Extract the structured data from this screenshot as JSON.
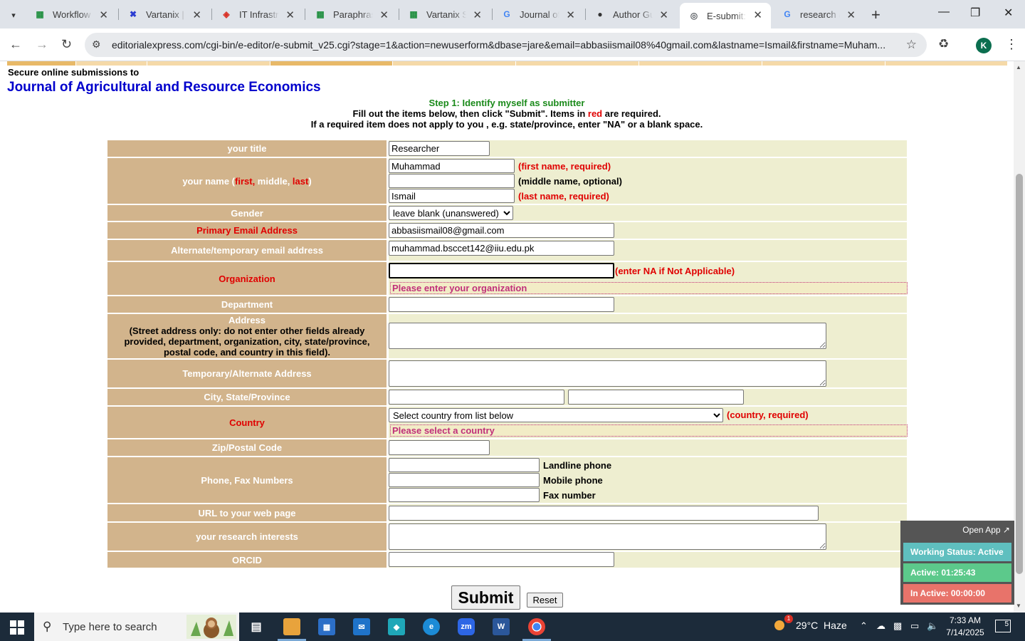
{
  "browser": {
    "tabs": [
      {
        "label": "Workflow F",
        "icon": "sheets-icon",
        "color": "#1e8e3e"
      },
      {
        "label": "Vartanix | S",
        "icon": "vartanix-icon",
        "color": "#2a3cd1"
      },
      {
        "label": "IT Infrastru",
        "icon": "diamond-icon",
        "color": "#d93025"
      },
      {
        "label": "Paraphrasin",
        "icon": "sheets-icon",
        "color": "#1e8e3e"
      },
      {
        "label": "Vartanix Se",
        "icon": "sheets-icon",
        "color": "#1e8e3e"
      },
      {
        "label": "Journal of A",
        "icon": "google-icon",
        "color": "#4285f4"
      },
      {
        "label": "Author Gui",
        "icon": "github-icon",
        "color": "#333333"
      },
      {
        "label": "E-submit: s",
        "icon": "globe-icon",
        "color": "#5f6368"
      },
      {
        "label": "research as",
        "icon": "google-icon",
        "color": "#4285f4"
      }
    ],
    "active_tab": 7,
    "url": "editorialexpress.com/cgi-bin/e-editor/e-submit_v25.cgi?stage=1&action=newuserform&dbase=jare&email=abbasiismail08%40gmail.com&lastname=Ismail&firstname=Muham...",
    "profile_initial": "K"
  },
  "header": {
    "secure_text": "Secure online submissions to",
    "journal_title": "Journal of Agricultural and Resource Economics"
  },
  "instructions": {
    "step": "Step 1: Identify myself as submitter",
    "line1_a": "Fill out the items below, then click \"Submit\". Items in ",
    "line1_red": "red",
    "line1_b": " are required.",
    "line2": "If a required item does not apply to you , e.g. state/province, enter \"NA\" or a blank space."
  },
  "form": {
    "title": {
      "label": "your title",
      "value": "Researcher"
    },
    "name": {
      "label_a": "your name (",
      "label_first": "first,",
      "label_mid": " middle, ",
      "label_last": "last",
      "label_close": ")",
      "first": "Muhammad",
      "first_hint": "(first name, required)",
      "middle": "",
      "middle_hint": "(middle name, optional)",
      "last": "Ismail",
      "last_hint": "(last name, required)"
    },
    "gender": {
      "label": "Gender",
      "value": "leave blank (unanswered)"
    },
    "email": {
      "label": "Primary Email Address",
      "value": "abbasiismail08@gmail.com"
    },
    "alt_email": {
      "label": "Alternate/temporary email address",
      "value": "muhammad.bsccet142@iiu.edu.pk"
    },
    "organization": {
      "label": "Organization",
      "value": "",
      "hint": "(enter NA if Not Applicable)",
      "error": "Please enter your organization"
    },
    "department": {
      "label": "Department",
      "value": ""
    },
    "address": {
      "title": "Address",
      "note": "(Street address only: do not enter other fields already provided, department, organization, city, state/province, postal code, and country in this field).",
      "value": ""
    },
    "temp_address": {
      "label": "Temporary/Alternate Address",
      "value": ""
    },
    "city_state": {
      "label": "City, State/Province",
      "city": "",
      "state": ""
    },
    "country": {
      "label": "Country",
      "value": "Select country from list below",
      "hint": "(country, required)",
      "error": "Please select a country"
    },
    "zip": {
      "label": "Zip/Postal Code",
      "value": ""
    },
    "phones": {
      "label": "Phone, Fax Numbers",
      "landline": "Landline phone",
      "mobile": "Mobile phone",
      "fax": "Fax number"
    },
    "url": {
      "label": "URL to your web page",
      "value": ""
    },
    "research": {
      "label": "your research interests",
      "value": ""
    },
    "orcid": {
      "label": "ORCID",
      "value": ""
    },
    "submit_label": "Submit",
    "reset_label": "Reset"
  },
  "tracker": {
    "open_app": "Open App ↗",
    "status": "Working Status: Active",
    "active": "Active: 01:25:43",
    "inactive": "In Active: 00:00:00",
    "status_color": "#5fbfbf",
    "active_color": "#5cc98b",
    "inactive_color": "#e8736a"
  },
  "taskbar": {
    "search_placeholder": "Type here to search",
    "weather": "29°C  Haze",
    "weather_badge": "1",
    "time": "7:33 AM",
    "date": "7/14/2025",
    "notifications": "5"
  }
}
